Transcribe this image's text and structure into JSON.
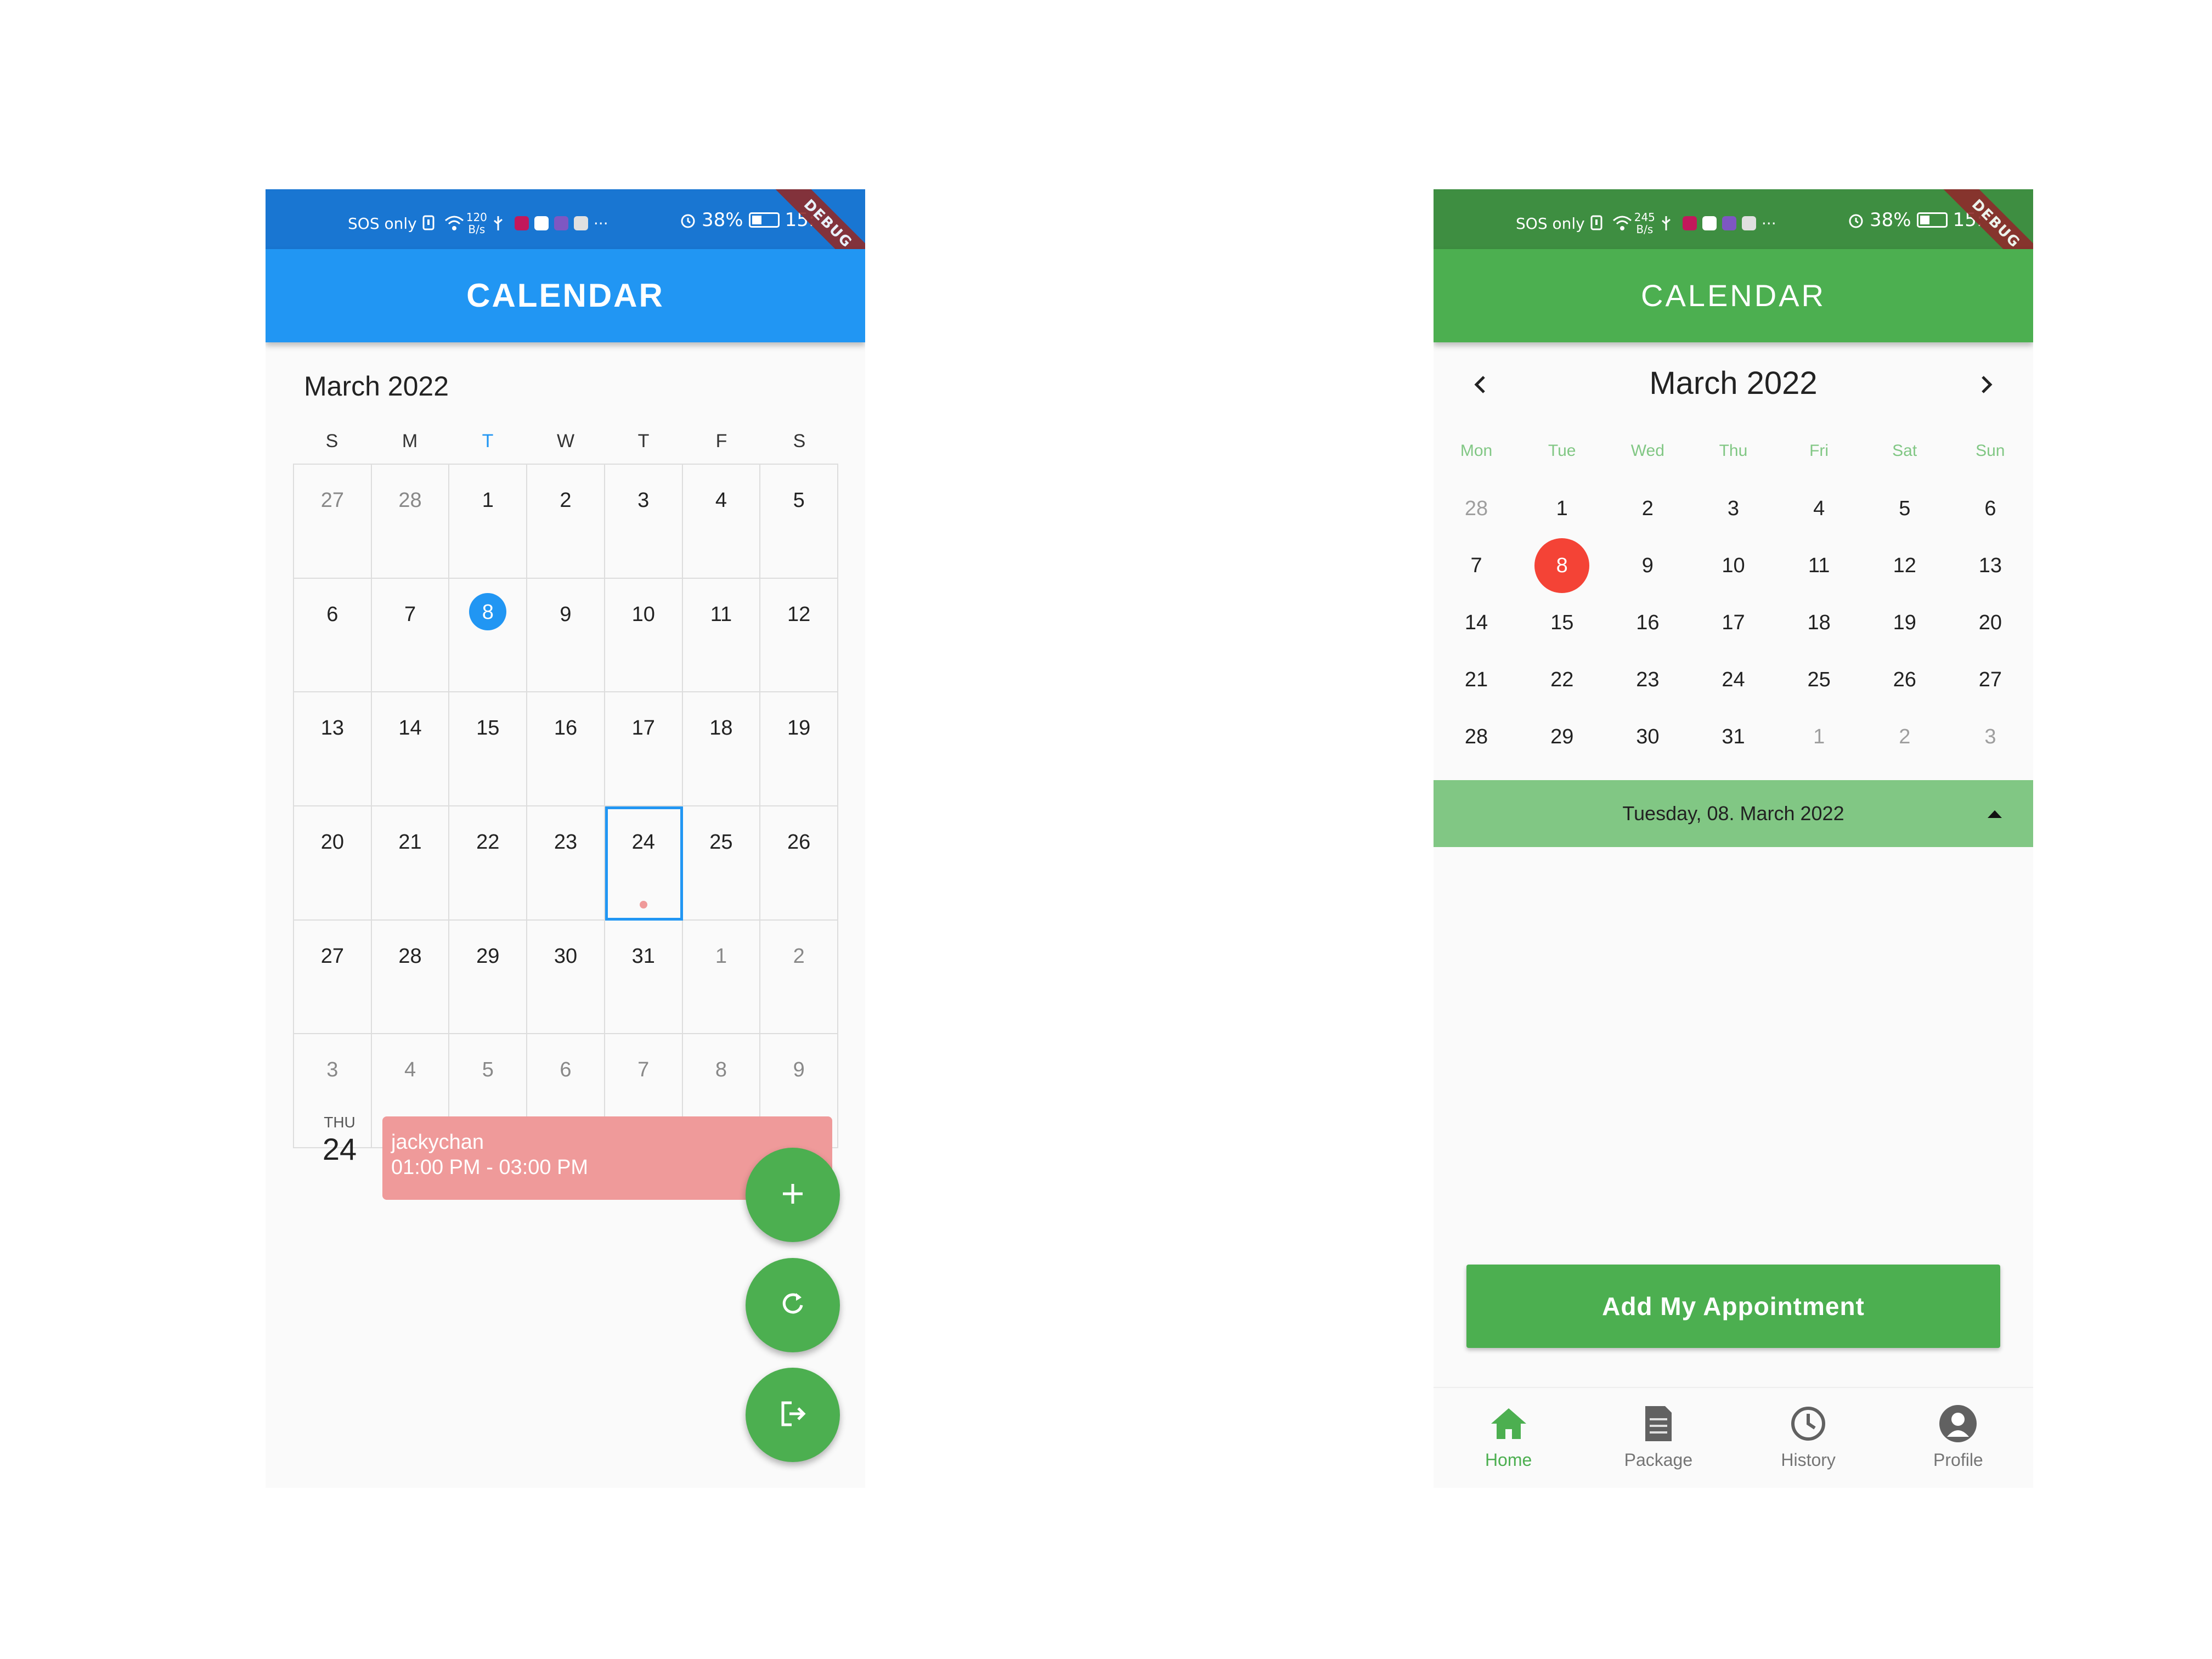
{
  "status_bar": {
    "left": {
      "sos": "SOS only",
      "speed": [
        "120",
        "B/s"
      ]
    },
    "right": {
      "sos": "SOS only",
      "speed": [
        "245",
        "B/s"
      ]
    },
    "battery": "38%",
    "time": "15:",
    "debug": "DEBUG"
  },
  "left": {
    "app_title": "CALENDAR",
    "month": "March 2022",
    "weekdays": [
      "S",
      "M",
      "T",
      "W",
      "T",
      "F",
      "S"
    ],
    "weekday_today_color": "#2196f3",
    "days": [
      [
        "27",
        "28",
        "1",
        "2",
        "3",
        "4",
        "5"
      ],
      [
        "6",
        "7",
        "8",
        "9",
        "10",
        "11",
        "12"
      ],
      [
        "13",
        "14",
        "15",
        "16",
        "17",
        "18",
        "19"
      ],
      [
        "20",
        "21",
        "22",
        "23",
        "24",
        "25",
        "26"
      ],
      [
        "27",
        "28",
        "29",
        "30",
        "31",
        "1",
        "2"
      ],
      [
        "3",
        "4",
        "5",
        "6",
        "7",
        "8",
        "9"
      ]
    ],
    "today": "8",
    "selected": "24",
    "agenda": {
      "dow": "THU",
      "day": "24"
    },
    "event": {
      "title": "jackychan",
      "time": "01:00 PM - 03:00 PM",
      "color": "#ef9a9a"
    },
    "fabs": [
      "add-icon",
      "refresh-icon",
      "logout-icon"
    ],
    "accent": "#2196f3"
  },
  "right": {
    "app_title": "CALENDAR",
    "month": "March 2022",
    "weekdays": [
      "Mon",
      "Tue",
      "Wed",
      "Thu",
      "Fri",
      "Sat",
      "Sun"
    ],
    "days": [
      [
        "28",
        "1",
        "2",
        "3",
        "4",
        "5",
        "6"
      ],
      [
        "7",
        "8",
        "9",
        "10",
        "11",
        "12",
        "13"
      ],
      [
        "14",
        "15",
        "16",
        "17",
        "18",
        "19",
        "20"
      ],
      [
        "21",
        "22",
        "23",
        "24",
        "25",
        "26",
        "27"
      ],
      [
        "28",
        "29",
        "30",
        "31",
        "1",
        "2",
        "3"
      ]
    ],
    "today": "8",
    "selected_date": "Tuesday, 08. March 2022",
    "add_button": "Add My Appointment",
    "nav": [
      {
        "label": "Home",
        "icon": "home-icon",
        "active": true
      },
      {
        "label": "Package",
        "icon": "document-icon",
        "active": false
      },
      {
        "label": "History",
        "icon": "history-icon",
        "active": false
      },
      {
        "label": "Profile",
        "icon": "profile-icon",
        "active": false
      }
    ],
    "accent": "#4caf50",
    "today_color": "#f44336"
  }
}
